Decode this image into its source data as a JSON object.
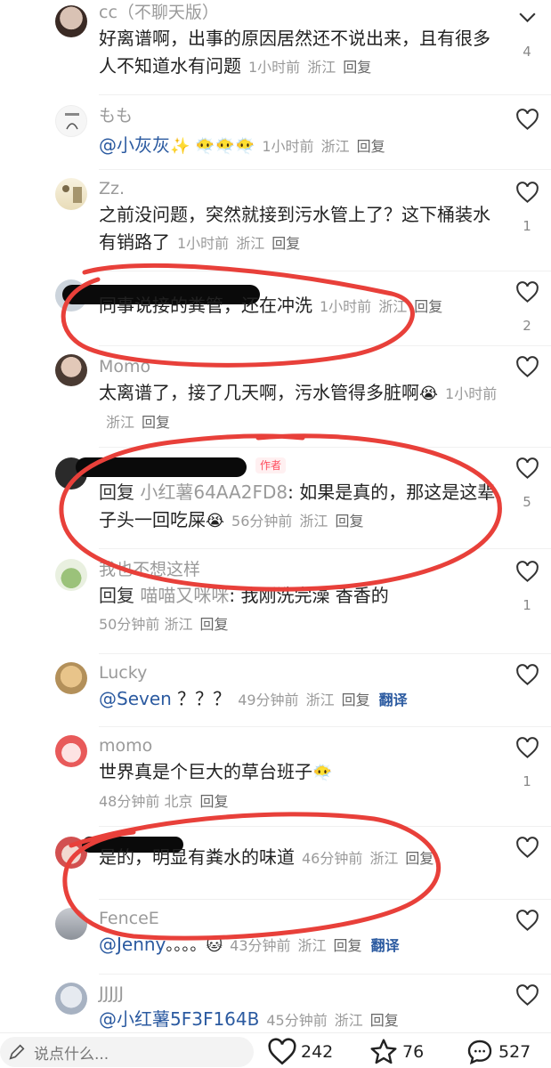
{
  "comments": [
    {
      "username": "cc（不聊天版）",
      "text": "好离谱啊，出事的原因居然还不说出来，且有很多人不知道水有问题",
      "time": "1小时前",
      "location": "浙江",
      "reply": "回复",
      "likes": "4"
    },
    {
      "username": "もも",
      "mention": "@小灰灰",
      "emojis": "✨ 😶‍🌫️😶‍🌫️😶‍🌫️",
      "time": "1小时前",
      "location": "浙江",
      "reply": "回复",
      "likes": ""
    },
    {
      "username": "Zz.",
      "text": "之前没问题，突然就接到污水管上了？这下桶装水有销路了",
      "time": "1小时前",
      "location": "浙江",
      "reply": "回复",
      "likes": "1"
    },
    {
      "username": "",
      "text": "同事说接的粪管，还在冲洗",
      "time": "1小时前",
      "location": "浙江",
      "reply": "回复",
      "likes": "2"
    },
    {
      "username": "Momo",
      "text": "太离谱了，接了几天啊，污水管得多脏啊",
      "emojis": "😭",
      "time": "1小时前",
      "location": "浙江",
      "reply": "回复",
      "likes": ""
    },
    {
      "username": "",
      "author_tag": "作者",
      "prefix": "回复",
      "quoted": "小红薯64AA2FD8",
      "text": ": 如果是真的，那这是这辈子头一回吃屎",
      "emojis": "😭",
      "time": "56分钟前",
      "location": "浙江",
      "reply": "回复",
      "likes": "5"
    },
    {
      "username": "我也不想这样",
      "prefix": "回复",
      "quoted": "喵喵又咪咪",
      "text": ": 我刚洗完澡 香香的",
      "time": "50分钟前",
      "location": "浙江",
      "reply": "回复",
      "likes": "1"
    },
    {
      "username": "Lucky",
      "mention": "@Seven",
      "text": " ？？？",
      "time": "49分钟前",
      "location": "浙江",
      "reply": "回复",
      "translate": "翻译",
      "likes": ""
    },
    {
      "username": "momo",
      "text": "世界真是个巨大的草台班子",
      "emojis": "😶‍🌫️",
      "time": "48分钟前",
      "location": "北京",
      "reply": "回复",
      "likes": "1"
    },
    {
      "username": "",
      "text": "是的，明显有粪水的味道",
      "time": "46分钟前",
      "location": "浙江",
      "reply": "回复",
      "likes": ""
    },
    {
      "username": "FenceE",
      "mention": "@Jenny",
      "emojis": "。。。。🐱",
      "time": "43分钟前",
      "location": "浙江",
      "reply": "回复",
      "translate": "翻译",
      "likes": ""
    },
    {
      "username": "JJJJJ",
      "mention": "@小红薯5F3F164B",
      "time": "45分钟前",
      "location": "浙江",
      "reply": "回复",
      "likes": ""
    }
  ],
  "bottom_bar": {
    "input_placeholder": "说点什么...",
    "likes": "242",
    "favorites": "76",
    "comments": "527"
  }
}
